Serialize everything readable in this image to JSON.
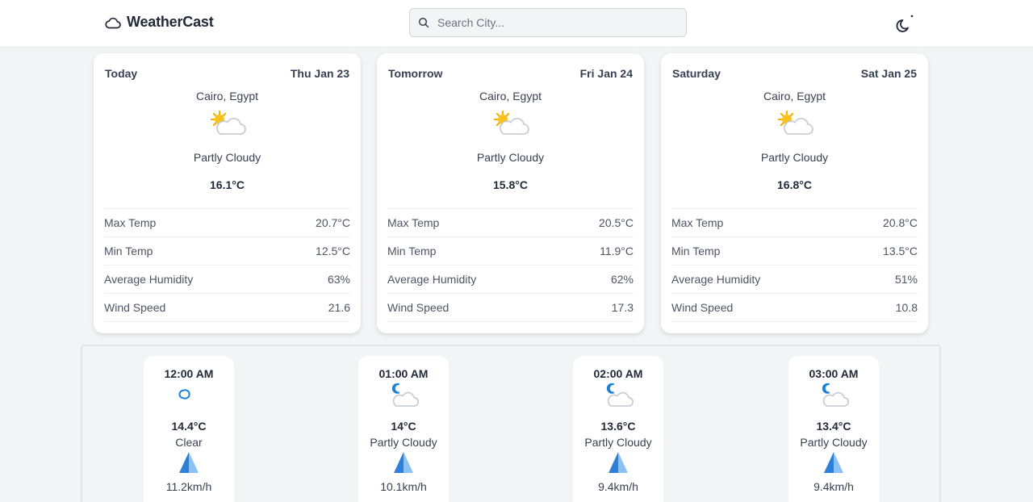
{
  "header": {
    "brand": "WeatherCast",
    "search_placeholder": "Search City..."
  },
  "days": [
    {
      "label": "Today",
      "date": "Thu Jan 23",
      "location": "Cairo, Egypt",
      "condition": "Partly Cloudy",
      "temp": "16.1°C",
      "rows": [
        {
          "label": "Max Temp",
          "value": "20.7°C"
        },
        {
          "label": "Min Temp",
          "value": "12.5°C"
        },
        {
          "label": "Average Humidity",
          "value": "63%"
        },
        {
          "label": "Wind Speed",
          "value": "21.6"
        }
      ]
    },
    {
      "label": "Tomorrow",
      "date": "Fri Jan 24",
      "location": "Cairo, Egypt",
      "condition": "Partly Cloudy",
      "temp": "15.8°C",
      "rows": [
        {
          "label": "Max Temp",
          "value": "20.5°C"
        },
        {
          "label": "Min Temp",
          "value": "11.9°C"
        },
        {
          "label": "Average Humidity",
          "value": "62%"
        },
        {
          "label": "Wind Speed",
          "value": "17.3"
        }
      ]
    },
    {
      "label": "Saturday",
      "date": "Sat Jan 25",
      "location": "Cairo, Egypt",
      "condition": "Partly Cloudy",
      "temp": "16.8°C",
      "rows": [
        {
          "label": "Max Temp",
          "value": "20.8°C"
        },
        {
          "label": "Min Temp",
          "value": "13.5°C"
        },
        {
          "label": "Average Humidity",
          "value": "51%"
        },
        {
          "label": "Wind Speed",
          "value": "10.8"
        }
      ]
    }
  ],
  "hourly": [
    {
      "time": "12:00 AM",
      "icon": "moon-icon",
      "temp": "14.4°C",
      "condition": "Clear",
      "wind": "11.2km/h"
    },
    {
      "time": "01:00 AM",
      "icon": "moon-cloud-icon",
      "temp": "14°C",
      "condition": "Partly Cloudy",
      "wind": "10.1km/h"
    },
    {
      "time": "02:00 AM",
      "icon": "moon-cloud-icon",
      "temp": "13.6°C",
      "condition": "Partly Cloudy",
      "wind": "9.4km/h"
    },
    {
      "time": "03:00 AM",
      "icon": "moon-cloud-icon",
      "temp": "13.4°C",
      "condition": "Partly Cloudy",
      "wind": "9.4km/h"
    }
  ],
  "colors": {
    "accent": "#1d7fd6",
    "sun": "#f5b301",
    "cloud": "#c9ced6"
  }
}
